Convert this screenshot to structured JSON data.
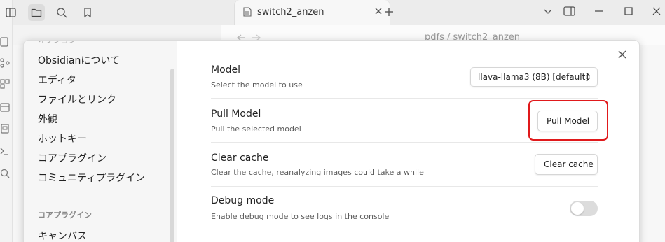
{
  "app": {
    "tab_title": "switch2_anzen",
    "breadcrumb": "pdfs / switch2_anzen"
  },
  "colors": {
    "accent_highlight": "#e0191b",
    "modal_bg": "#ffffff",
    "sidebar_bg": "#f6f6f6"
  },
  "settings_sidebar": {
    "cut_header": "オプション",
    "items": [
      {
        "label": "Obsidianについて"
      },
      {
        "label": "エディタ"
      },
      {
        "label": "ファイルとリンク"
      },
      {
        "label": "外観"
      },
      {
        "label": "ホットキー"
      },
      {
        "label": "コアプラグイン"
      },
      {
        "label": "コミュニティプラグイン"
      }
    ],
    "section_label": "コアプラグイン",
    "section_items": [
      {
        "label": "キャンバス"
      }
    ]
  },
  "settings": {
    "model": {
      "name": "Model",
      "desc": "Select the model to use",
      "selected_option": "llava-llama3 (8B) [default]"
    },
    "pull_model": {
      "name": "Pull Model",
      "desc": "Pull the selected model",
      "button_label": "Pull Model"
    },
    "clear_cache": {
      "name": "Clear cache",
      "desc": "Clear the cache, reanalyzing images could take a while",
      "button_label": "Clear cache"
    },
    "debug_mode": {
      "name": "Debug mode",
      "desc": "Enable debug mode to see logs in the console",
      "enabled": false
    }
  }
}
